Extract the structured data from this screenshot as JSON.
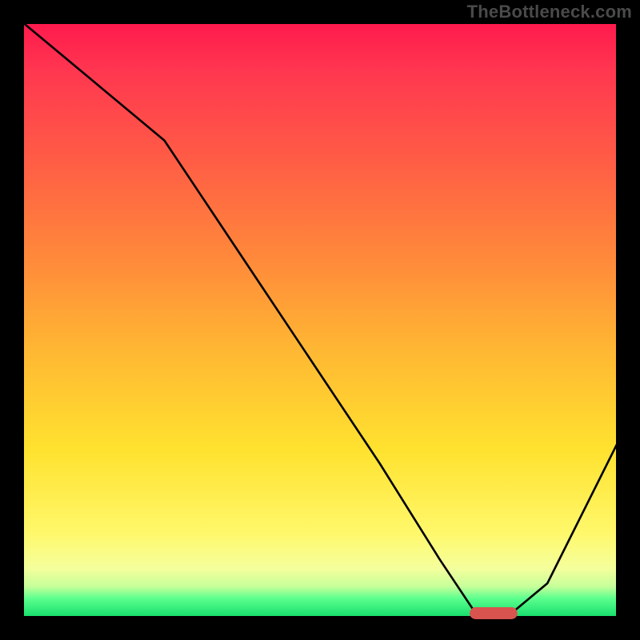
{
  "watermark": "TheBottleneck.com",
  "chart_data": {
    "type": "line",
    "title": "",
    "xlabel": "",
    "ylabel": "",
    "xlim": [
      0,
      100
    ],
    "ylim": [
      0,
      100
    ],
    "grid": false,
    "series": [
      {
        "name": "curve",
        "color": "#000000",
        "x": [
          0,
          12,
          24,
          36,
          48,
          60,
          70,
          76,
          82,
          88,
          100
        ],
        "y": [
          100,
          90,
          80,
          62,
          44,
          26,
          10,
          1,
          1,
          6,
          30
        ]
      }
    ],
    "marker": {
      "name": "highlighted-segment",
      "color": "#d9534f",
      "x_center": 79,
      "y": 1,
      "width_x": 8,
      "height_y": 2,
      "shape": "rounded-rect"
    },
    "background_gradient": {
      "top_color": "#ff1a4d",
      "upper_mid_color": "#ff8a3a",
      "mid_color": "#ffe22f",
      "lower_mid_color": "#f4ff9c",
      "bottom_color": "#18e06e"
    }
  }
}
